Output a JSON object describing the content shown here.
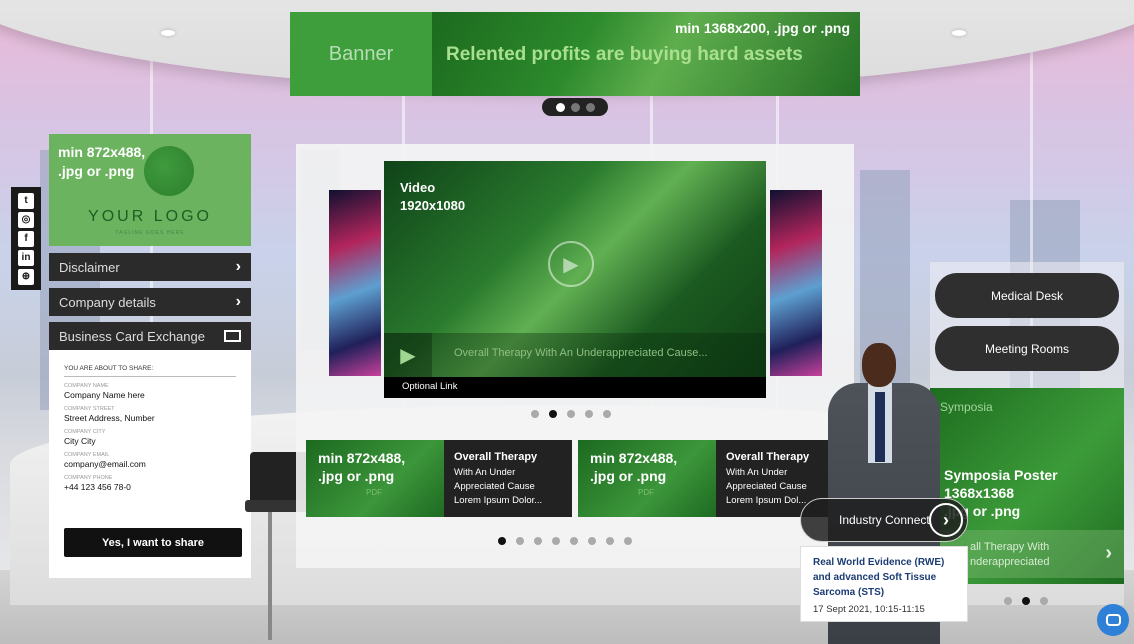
{
  "banner": {
    "label": "Banner",
    "spec": "min 1368x200, .jpg or .png",
    "tagline": "Relented profits are buying hard assets"
  },
  "social": {
    "icons": [
      "twitter-icon",
      "instagram-icon",
      "facebook-icon",
      "linkedin-icon",
      "globe-icon"
    ],
    "glyphs": [
      "t",
      "◎",
      "f",
      "in",
      "⊕"
    ]
  },
  "logo": {
    "spec": "min 872x488,\n.jpg or .png",
    "spec_line1": "min 872x488,",
    "spec_line2": ".jpg or .png",
    "text": "YOUR LOGO",
    "tagline": "TAGLINE GOES HERE"
  },
  "menu": {
    "disclaimer": "Disclaimer",
    "company_details": "Company details",
    "business_card": "Business Card Exchange"
  },
  "share": {
    "title": "YOU ARE ABOUT TO SHARE:",
    "fields": [
      {
        "label": "COMPANY NAME",
        "value": "Company Name here"
      },
      {
        "label": "COMPANY STREET",
        "value": "Street Address, Number"
      },
      {
        "label": "COMPANY CITY",
        "value": "City City"
      },
      {
        "label": "COMPANY EMAIL",
        "value": "company@email.com"
      },
      {
        "label": "COMPANY PHONE",
        "value": "+44 123 456 78-0"
      }
    ],
    "button": "Yes, I want to share"
  },
  "video": {
    "spec_line1": "Video",
    "spec_line2": "1920x1080",
    "caption": "Overall Therapy With An Underappreciated Cause...",
    "optional_link": "Optional Link"
  },
  "docs": [
    {
      "spec_line1": "min 872x488,",
      "spec_line2": ".jpg or .png",
      "pdf": "PDF",
      "title": "Overall Therapy",
      "line1": "With An Under",
      "line2": "Appreciated Cause",
      "line3": "Lorem Ipsum Dolor..."
    },
    {
      "spec_line1": "min 872x488,",
      "spec_line2": ".jpg or .png",
      "pdf": "PDF",
      "title": "Overall Therapy",
      "line1": "With An Under",
      "line2": "Appreciated Cause",
      "line3": "Lorem Ipsum Dol..."
    }
  ],
  "right": {
    "medical_desk": "Medical Desk",
    "meeting_rooms": "Meeting Rooms",
    "symposia_header": "Symposia",
    "symposia_line1": "Symposia Poster",
    "symposia_line2": "1368x1368",
    "symposia_line3": ".jpg or .png",
    "symposia_cap1": "all Therapy With",
    "symposia_cap2": "nderappreciated"
  },
  "industry_connect": {
    "label": "Industry Connect",
    "event_title": "Real World Evidence (RWE) and advanced Soft Tissue Sarcoma (STS)",
    "event_date": "17 Sept 2021, 10:15-11:15"
  },
  "colors": {
    "accent_green": "#3d9e3b",
    "dark": "#2b2b2b",
    "chat_blue": "#2f80d7"
  }
}
